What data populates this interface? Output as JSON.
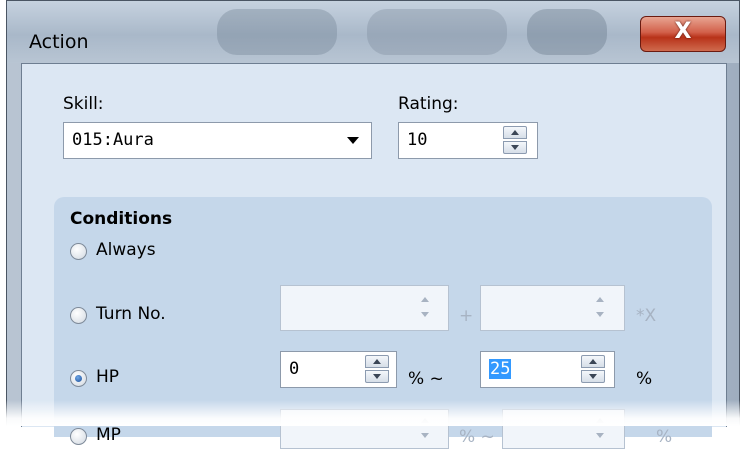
{
  "window": {
    "title": "Action",
    "close_symbol": "X"
  },
  "skill": {
    "label": "Skill:",
    "selected": "015:Aura"
  },
  "rating": {
    "label": "Rating:",
    "value": "10"
  },
  "conditions": {
    "title": "Conditions",
    "options": [
      {
        "label": "Always",
        "checked": false,
        "enabled": true
      },
      {
        "label": "Turn No.",
        "checked": false,
        "enabled": true
      },
      {
        "label": "HP",
        "checked": true,
        "enabled": true
      },
      {
        "label": "MP",
        "checked": false,
        "enabled": true
      }
    ],
    "turn_no": {
      "value1": "",
      "plus": "+",
      "value2": "",
      "suffix": "*X"
    },
    "hp": {
      "min": "0",
      "percent_tilde": "% ~",
      "max": "25",
      "percent": "%"
    },
    "mp": {
      "min": "",
      "percent_tilde": "% ~",
      "max": "",
      "percent": "%"
    }
  },
  "icons": {
    "close": "close-icon",
    "dropdown": "chevron-down-icon",
    "spin_up": "spin-up-icon",
    "spin_down": "spin-down-icon"
  }
}
